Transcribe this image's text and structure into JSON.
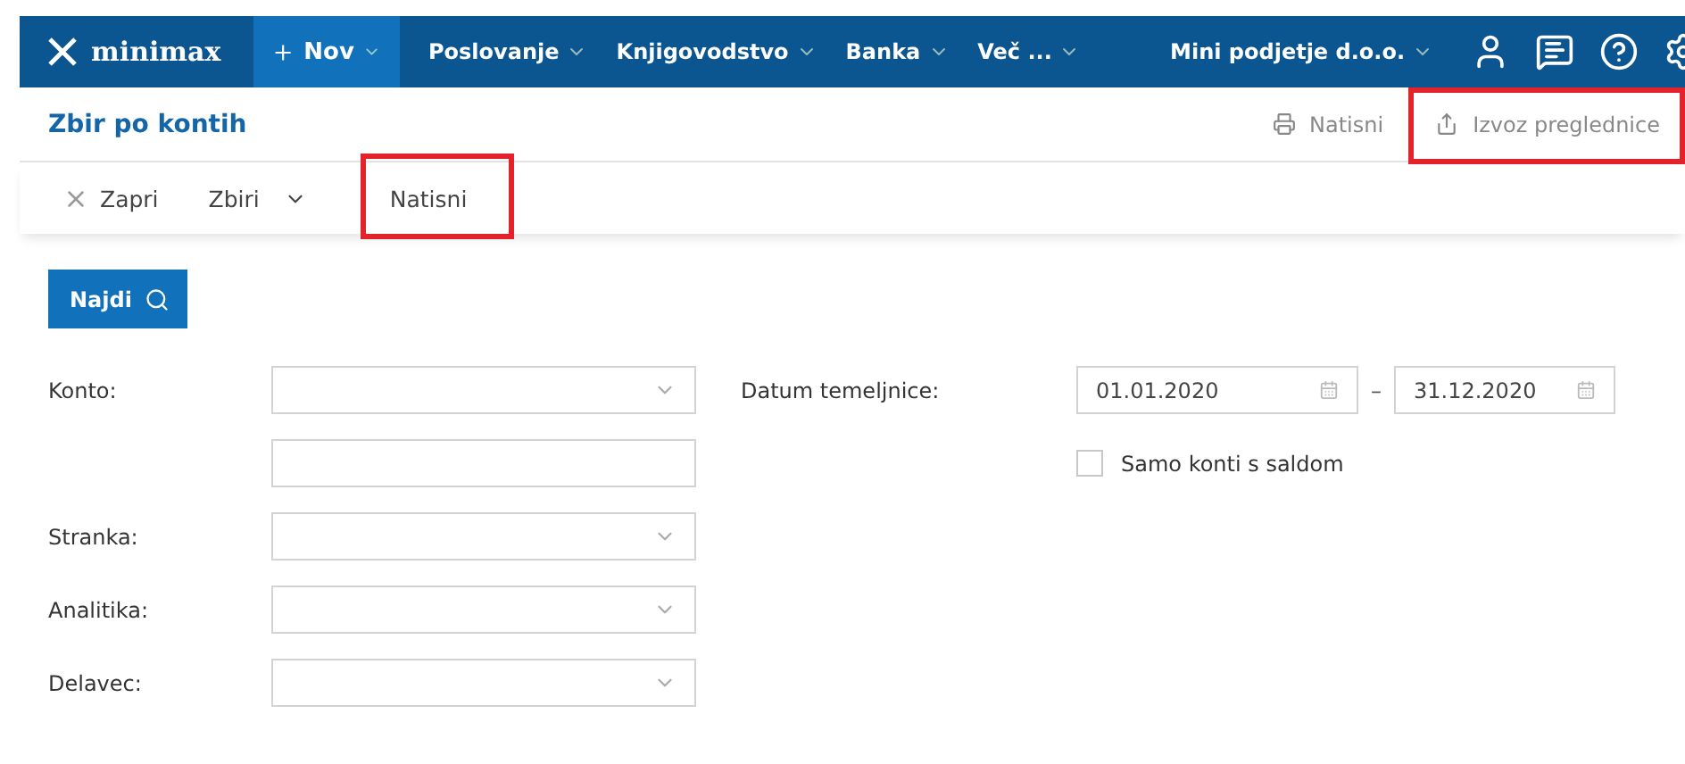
{
  "nav": {
    "logo": "minimax",
    "new_button": "Nov",
    "menu": [
      {
        "label": "Poslovanje"
      },
      {
        "label": "Knjigovodstvo"
      },
      {
        "label": "Banka"
      },
      {
        "label": "Več ..."
      }
    ],
    "company": "Mini podjetje d.o.o."
  },
  "header": {
    "title": "Zbir po kontih",
    "actions": [
      {
        "kind": "print",
        "label": "Natisni",
        "highlighted": false
      },
      {
        "kind": "export",
        "label": "Izvoz preglednice",
        "highlighted": true
      }
    ]
  },
  "toolbar": [
    {
      "kind": "close",
      "label": "Zapri",
      "highlighted": false
    },
    {
      "kind": "dropdown",
      "label": "Zbiri",
      "highlighted": false
    },
    {
      "kind": "plain",
      "label": "Natisni",
      "highlighted": true
    }
  ],
  "search_button": "Najdi",
  "filters": [
    {
      "label": "Konto:",
      "kind": "select"
    },
    {
      "kind": "text"
    },
    {
      "label": "Stranka:",
      "kind": "select"
    },
    {
      "label": "Analitika:",
      "kind": "select"
    },
    {
      "label": "Delavec:",
      "kind": "select"
    }
  ],
  "date": {
    "label": "Datum temeljnice:",
    "from": "01.01.2020",
    "separator": "–",
    "to": "31.12.2020"
  },
  "balance_only": {
    "label": "Samo konti s saldom",
    "checked": false
  }
}
